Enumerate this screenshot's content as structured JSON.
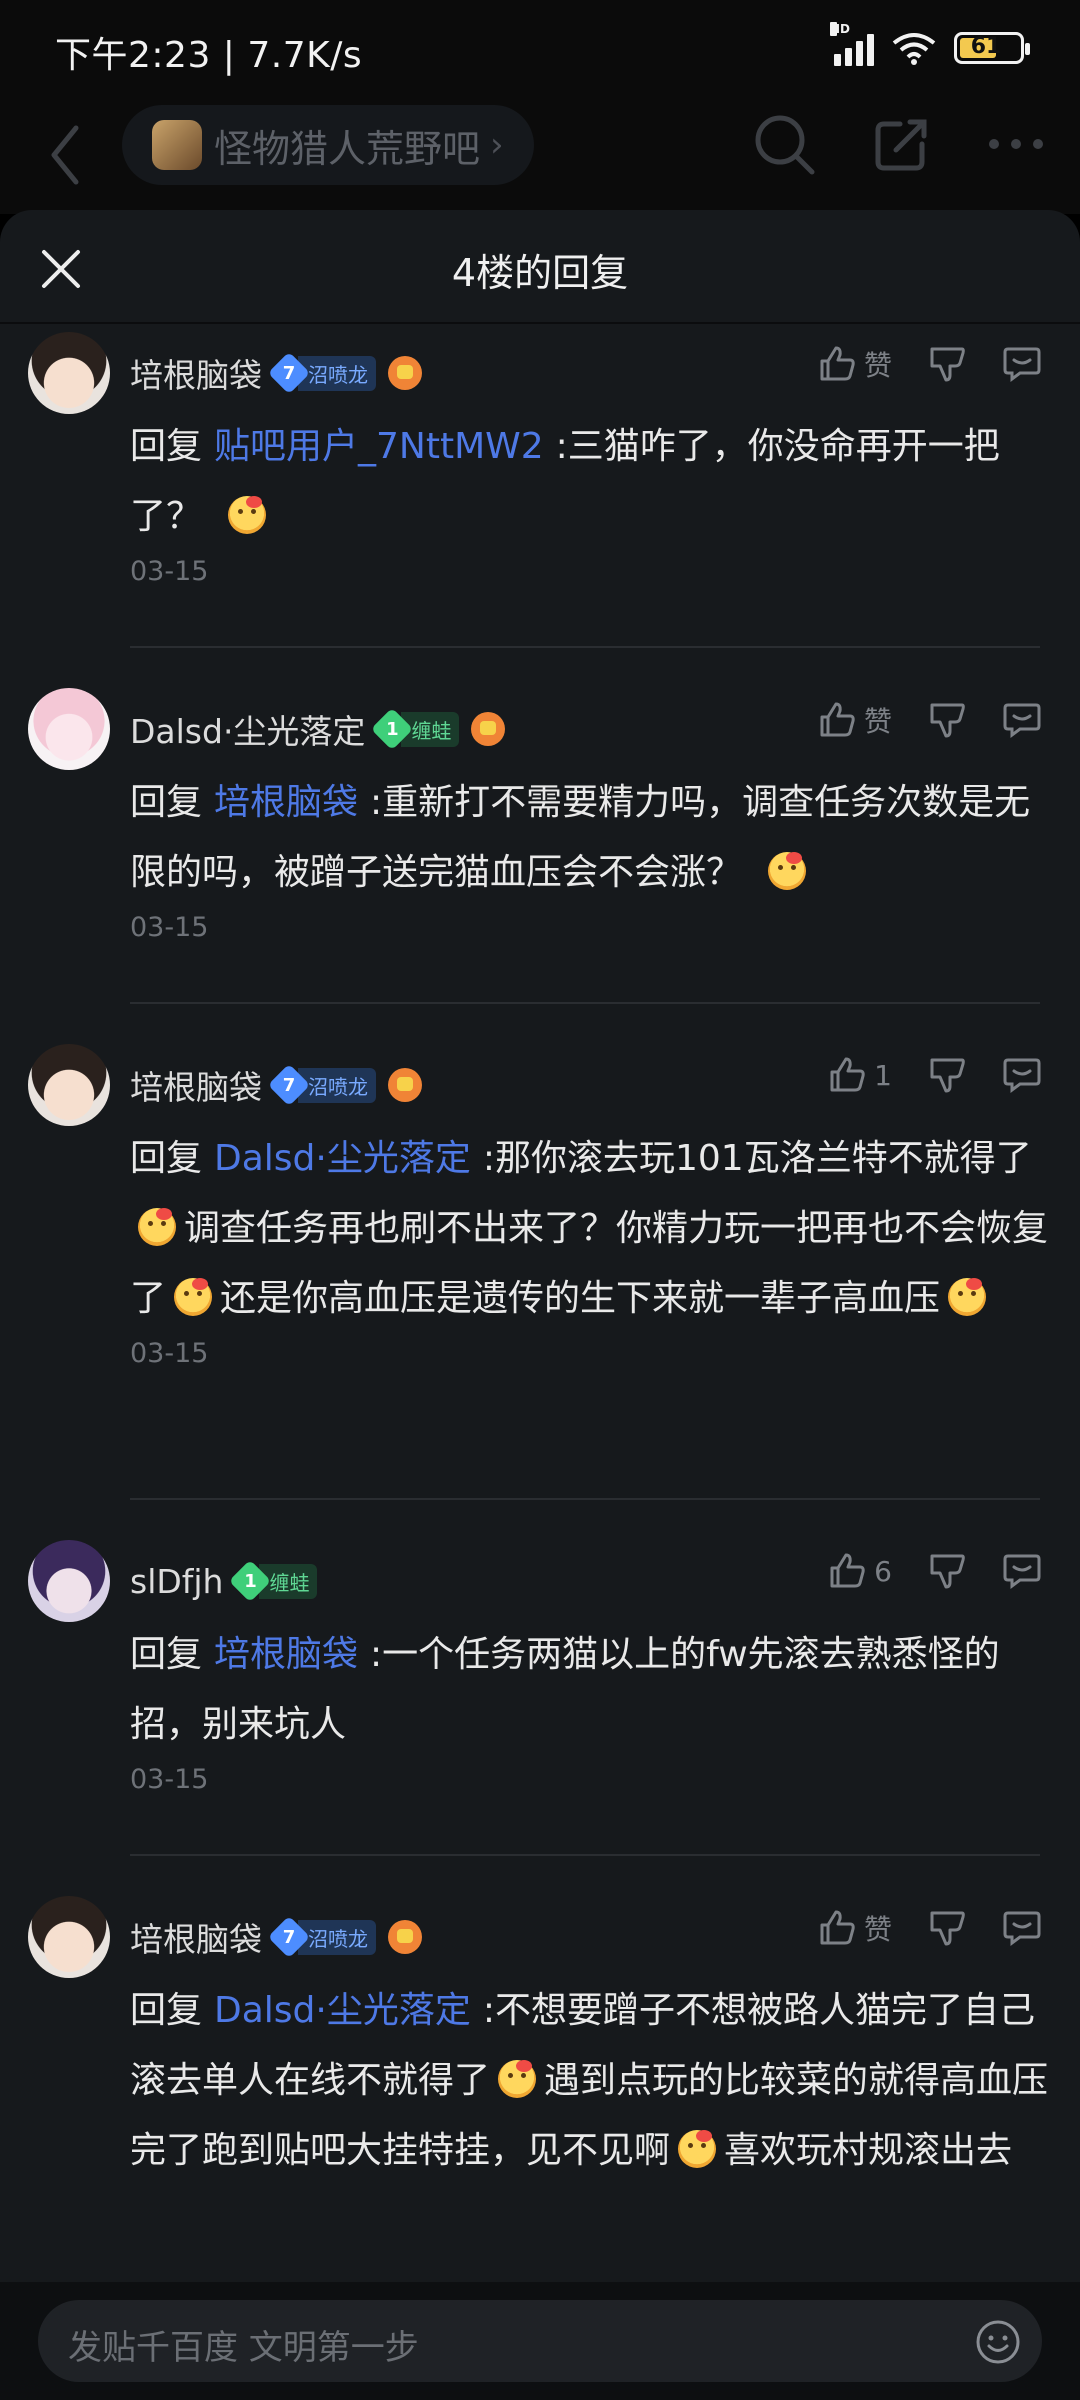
{
  "status": {
    "time": "下午2:23",
    "net_speed": "7.7K/s",
    "battery": "61",
    "signal_label": "HD"
  },
  "nav": {
    "forum_name": "怪物猎人荒野吧",
    "chevron": "›"
  },
  "sheet": {
    "title": "4楼的回复"
  },
  "comments": [
    {
      "user": "培根脑袋",
      "level": "7",
      "level_title": "沼喷龙",
      "like_label": "赞",
      "reply_to": "贴吧用户_7NttMW2",
      "text_parts": [
        ":三猫咋了，你没命再开一把了？"
      ],
      "date": "03-15"
    },
    {
      "user": "Dalsd·尘光落定",
      "level": "1",
      "level_title": "缠蛙",
      "like_label": "赞",
      "reply_to": "培根脑袋",
      "text_parts": [
        ":重新打不需要精力吗，调查任务次数是无限的吗，被蹭子送完猫血压会不会涨？"
      ],
      "date": "03-15"
    },
    {
      "user": "培根脑袋",
      "level": "7",
      "level_title": "沼喷龙",
      "like_label": "1",
      "reply_to": "Dalsd·尘光落定",
      "text_parts": [
        ":那你滚去玩101瓦洛兰特不就得了",
        "调查任务再也刷不出来了？你精力玩一把再也不会恢复了",
        "还是你高血压是遗传的生下来就一辈子高血压"
      ],
      "date": "03-15"
    },
    {
      "user": "slDfjh",
      "level": "1",
      "level_title": "缠蛙",
      "like_label": "6",
      "reply_to": "培根脑袋",
      "text_parts": [
        ":一个任务两猫以上的fw先滚去熟悉怪的招，别来坑人"
      ],
      "date": "03-15"
    },
    {
      "user": "培根脑袋",
      "level": "7",
      "level_title": "沼喷龙",
      "like_label": "赞",
      "reply_to": "Dalsd·尘光落定",
      "text_parts": [
        ":不想要蹭子不想被路人猫完了自己滚去单人在线不就得了",
        "遇到点玩的比较菜的就得高血压完了跑到贴吧大挂特挂，见不见啊",
        "喜欢玩村规滚出去"
      ],
      "date": ""
    }
  ],
  "common": {
    "reply_kw": "回复"
  },
  "bottom": {
    "placeholder": "发贴千百度 文明第一步"
  },
  "colors": {
    "accent_link": "#4e79e6",
    "level_blue": "#4d8dff",
    "level_green": "#3fcf7a",
    "battery": "#f3c94f"
  }
}
